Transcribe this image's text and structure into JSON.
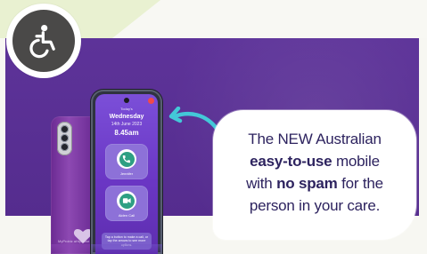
{
  "banner": {
    "message": {
      "line1": "The NEW Australian",
      "line2_bold": "easy-to-use",
      "line2_rest": " mobile",
      "line3_start": "with ",
      "line3_bold": "no spam",
      "line3_end": " for the",
      "line4": "person in your care."
    },
    "phone_screen": {
      "header": "Today's",
      "day": "Wednesday",
      "date": "14th June 2023",
      "time": "8.45am",
      "contact_1": "Jennifer",
      "contact_2": "Aiden Call",
      "footer": "Tap a button to make a call, or tap the arrows to see more options."
    },
    "phone_back_text": "MyProbiz\naHrphone"
  },
  "icons": {
    "accessibility": "wheelchair-icon",
    "arrow": "curved-arrow-icon",
    "phone_call": "phone-icon",
    "video_call": "video-icon",
    "heart": "heart-icon"
  },
  "colors": {
    "banner_bg": "#5a2f97",
    "message_text": "#2d235f",
    "accent_arrow": "#43c8d8",
    "icon_green": "#2e9f83",
    "badge_dark": "#4a4948"
  }
}
